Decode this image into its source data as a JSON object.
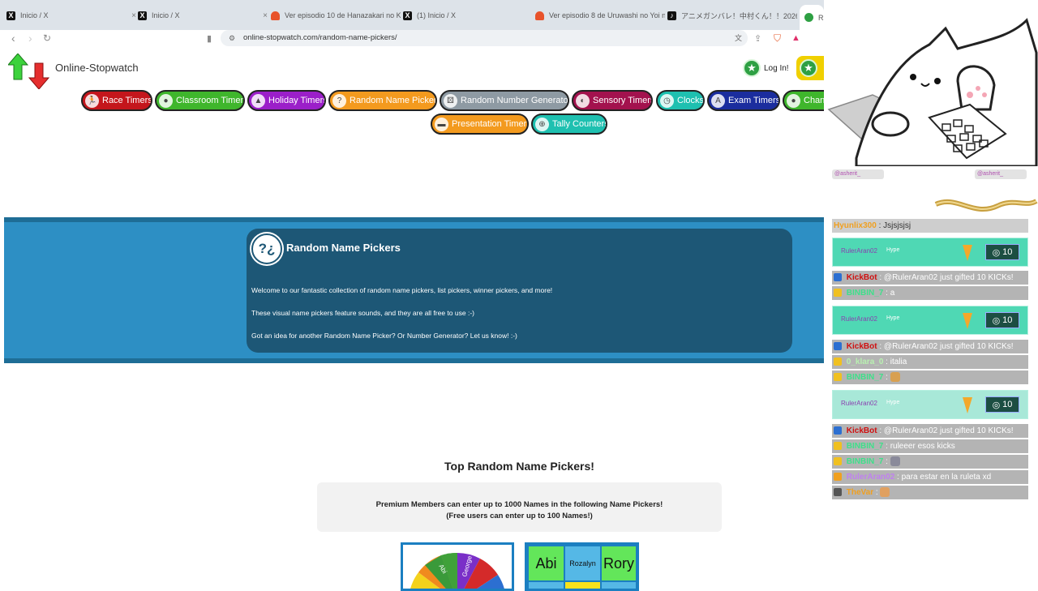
{
  "browser": {
    "tabs": [
      {
        "label": "Inicio / X",
        "favicon": "x-icon"
      },
      {
        "label": "Inicio / X",
        "favicon": "x-icon"
      },
      {
        "label": "Ver episodio 10 de Hanazakari no K...",
        "favicon": "heart-icon"
      },
      {
        "label": "(1) Inicio / X",
        "favicon": "x-icon"
      },
      {
        "label": "Ver episodio 8 de Uruwashi no Yoi n...",
        "favicon": "heart-icon"
      },
      {
        "label": "アニメガンバレ！中村くん！！2026年...",
        "favicon": "tiktok-icon"
      },
      {
        "label": "Ra",
        "favicon": "stopwatch-icon"
      }
    ],
    "url": "online-stopwatch.com/random-name-pickers/"
  },
  "site": {
    "title": "Online-Stopwatch",
    "login": "Log In!"
  },
  "categories": [
    {
      "label": "Race Timers",
      "color": "#c4161c"
    },
    {
      "label": "Classroom Timers",
      "color": "#3fb62c"
    },
    {
      "label": "Holiday Timers",
      "color": "#9b1fc9"
    },
    {
      "label": "Random Name Pickers",
      "color": "#f39a1e"
    },
    {
      "label": "Random Number Generators",
      "color": "#8e9aa3"
    },
    {
      "label": "Sensory Timers",
      "color": "#a3124e"
    },
    {
      "label": "Clocks",
      "color": "#1ec0b0"
    },
    {
      "label": "Exam Timers",
      "color": "#1b2d9e"
    },
    {
      "label": "Chan",
      "color": "#3fb62c"
    },
    {
      "label": "Presentation Timers",
      "color": "#f39a1e"
    },
    {
      "label": "Tally Counters",
      "color": "#1ec0b0"
    }
  ],
  "info": {
    "title": "Random Name Pickers",
    "p1": "Welcome to our fantastic collection of random name pickers, list pickers, winner pickers, and more!",
    "p2": "These visual name pickers feature sounds, and they are all free to use :-)",
    "p3": "Got an idea for another Random Name Picker? Or Number Generator? Let us know! :-)"
  },
  "main": {
    "heading": "Top Random Name Pickers!",
    "premium_line1": "Premium Members can enter up to 1000 Names in the following Name Pickers!",
    "premium_line2": "(Free users can enter up to 100 Names!)",
    "wheel_names": [
      "Abi",
      "George"
    ],
    "grid_names": [
      "Abi",
      "Rozalyn",
      "Rory"
    ]
  },
  "overlay": {
    "handle_left": "@asherit_",
    "handle_right": "@asherit_",
    "chat": [
      {
        "user": "Hyunlix300",
        "text": ": Jsjsjsjsj",
        "type": "msg"
      },
      {
        "user": "RulerAran02",
        "tag": "Hype",
        "count": "10",
        "type": "hype"
      },
      {
        "user": "KickBot",
        "text": ": @RulerAran02 just gifted 10 KICKs!",
        "type": "msg"
      },
      {
        "user": "BINBIN_7",
        "text": ": a",
        "type": "msg"
      },
      {
        "user": "RulerAran02",
        "tag": "Hype",
        "count": "10",
        "type": "hype"
      },
      {
        "user": "KickBot",
        "text": ": @RulerAran02 just gifted 10 KICKs!",
        "type": "msg"
      },
      {
        "user": "0_klara_0",
        "text": ": italia",
        "type": "msg"
      },
      {
        "user": "BINBIN_7",
        "text": ":",
        "type": "msg"
      },
      {
        "user": "RulerAran02",
        "tag": "Hype",
        "count": "10",
        "type": "hype"
      },
      {
        "user": "KickBot",
        "text": ": @RulerAran02 just gifted 10 KICKs!",
        "type": "msg"
      },
      {
        "user": "BINBIN_7",
        "text": ": ruleeer esos kicks",
        "type": "msg"
      },
      {
        "user": "BINBIN_7",
        "text": ":",
        "type": "msg"
      },
      {
        "user": "RulerAran02",
        "text": ": para estar en la ruleta xd",
        "type": "msg"
      },
      {
        "user": "TheVar",
        "text": ":",
        "type": "msg"
      }
    ]
  }
}
